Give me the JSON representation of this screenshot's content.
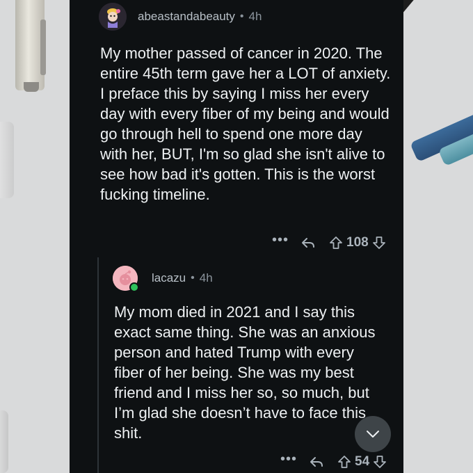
{
  "comments": [
    {
      "username": "abeastandabeauty",
      "separator": "•",
      "timestamp": "4h",
      "body": "My mother passed of cancer in 2020. The entire 45th term gave her a LOT of anxiety. I preface this by saying I miss her every day with every fiber of my being and would go through hell to spend one more day with her, BUT, I'm so glad she isn't alive to see how bad it's gotten. This is the worst fucking timeline.",
      "more_label": "•••",
      "votes": "108",
      "avatar_icon": "snoo-avatar-icon"
    },
    {
      "username": "lacazu",
      "separator": "•",
      "timestamp": "4h",
      "body": "My mom died in 2021 and I say this exact same thing. She was an anxious person and hated Trump with every fiber of her being. She was my best friend and I miss her so, so much, but I’m glad she doesn’t have to face this shit.",
      "more_label": "•••",
      "votes": "54",
      "avatar_icon": "snoo-avatar-icon",
      "online": true
    }
  ],
  "icons": {
    "reply": "reply-arrow-icon",
    "upvote": "upvote-arrow-icon",
    "downvote": "downvote-arrow-icon",
    "scroll_down": "chevron-down-icon"
  },
  "colors": {
    "card_background": "#0e1113",
    "text": "#eef1f3",
    "meta_text": "#8b949c",
    "online": "#2fc05b",
    "avatar_pink": "#f4b6bf"
  }
}
